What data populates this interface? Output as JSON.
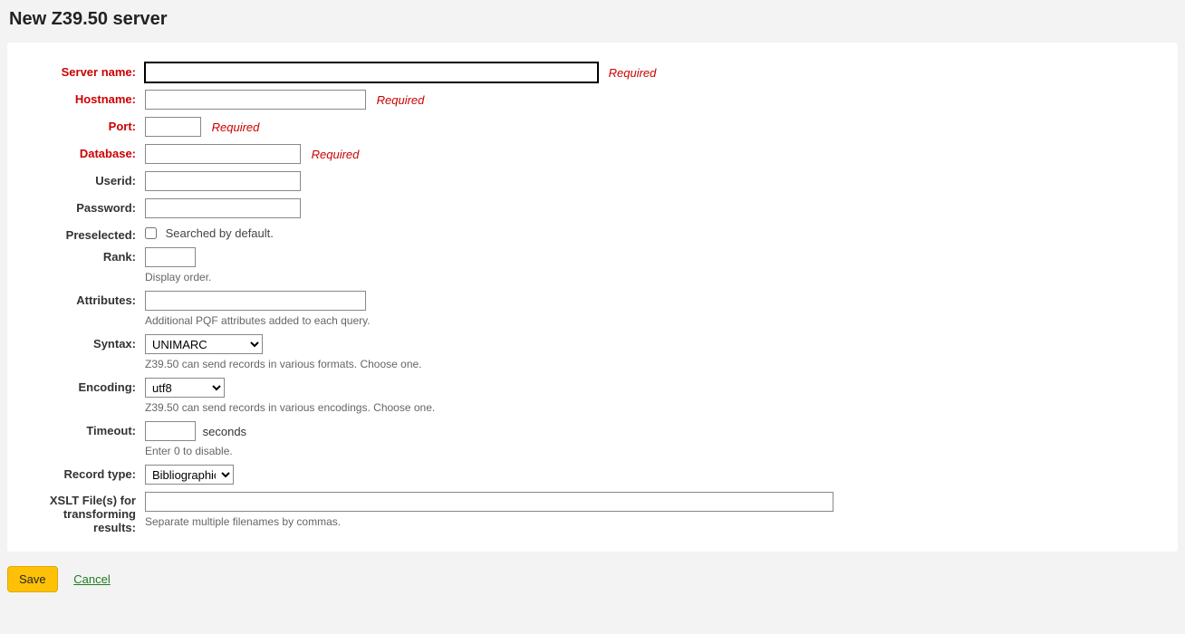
{
  "page": {
    "title": "New Z39.50 server"
  },
  "labels": {
    "server_name": "Server name:",
    "hostname": "Hostname:",
    "port": "Port:",
    "database": "Database:",
    "userid": "Userid:",
    "password": "Password:",
    "preselected": "Preselected:",
    "rank": "Rank:",
    "attributes": "Attributes:",
    "syntax": "Syntax:",
    "encoding": "Encoding:",
    "timeout": "Timeout:",
    "record_type": "Record type:",
    "xslt": "XSLT File(s) for transforming results:"
  },
  "required_text": "Required",
  "preselected_checkbox_label": "Searched by default.",
  "hints": {
    "rank": "Display order.",
    "attributes": "Additional PQF attributes added to each query.",
    "syntax": "Z39.50 can send records in various formats. Choose one.",
    "encoding": "Z39.50 can send records in various encodings. Choose one.",
    "timeout": "Enter 0 to disable.",
    "xslt": "Separate multiple filenames by commas."
  },
  "timeout_suffix": "seconds",
  "select": {
    "syntax_selected": "UNIMARC",
    "encoding_selected": "utf8",
    "record_type_selected": "Bibliographic"
  },
  "values": {
    "server_name": "",
    "hostname": "",
    "port": "",
    "database": "",
    "userid": "",
    "password": "",
    "rank": "",
    "attributes": "",
    "timeout": "",
    "xslt": ""
  },
  "actions": {
    "save": "Save",
    "cancel": "Cancel"
  }
}
